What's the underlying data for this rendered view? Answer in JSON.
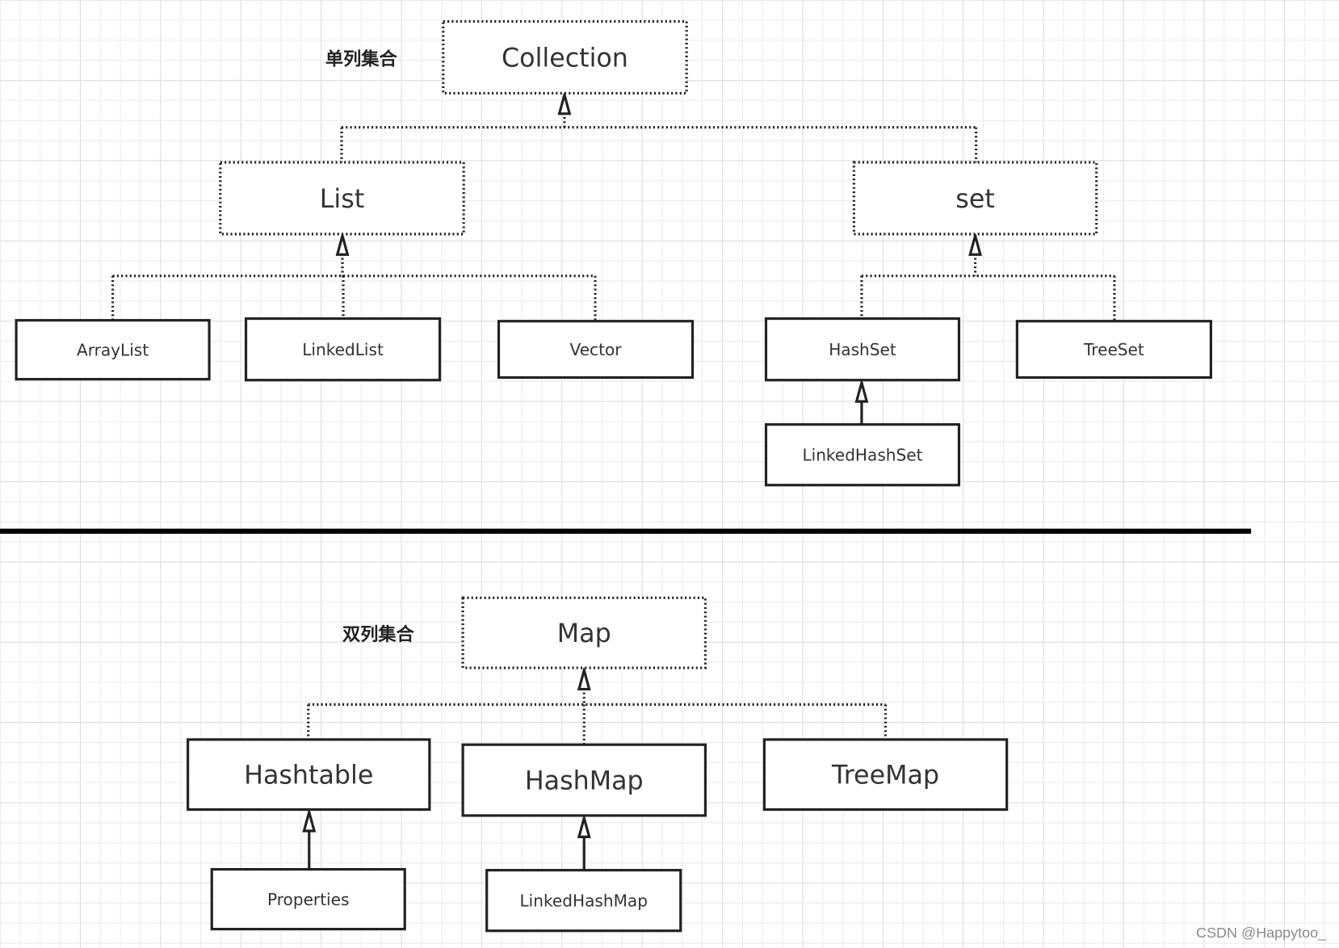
{
  "labels": {
    "single_column": "单列集合",
    "double_column": "双列集合",
    "watermark": "CSDN @Happytoo_"
  },
  "colors": {
    "line": "#222222",
    "grid_minor": "#ececec",
    "grid_major": "#dcdcdc",
    "separator": "#000000"
  },
  "nodes": [
    {
      "id": "collection",
      "label": "Collection",
      "kind": "interface"
    },
    {
      "id": "list",
      "label": "List",
      "kind": "interface"
    },
    {
      "id": "set",
      "label": "set",
      "kind": "interface"
    },
    {
      "id": "arraylist",
      "label": "ArrayList",
      "kind": "class"
    },
    {
      "id": "linkedlist",
      "label": "LinkedList",
      "kind": "class"
    },
    {
      "id": "vector",
      "label": "Vector",
      "kind": "class"
    },
    {
      "id": "hashset",
      "label": "HashSet",
      "kind": "class"
    },
    {
      "id": "treeset",
      "label": "TreeSet",
      "kind": "class"
    },
    {
      "id": "linkedhashset",
      "label": "LinkedHashSet",
      "kind": "class"
    },
    {
      "id": "map",
      "label": "Map",
      "kind": "interface"
    },
    {
      "id": "hashtable",
      "label": "Hashtable",
      "kind": "class"
    },
    {
      "id": "hashmap",
      "label": "HashMap",
      "kind": "class"
    },
    {
      "id": "treemap",
      "label": "TreeMap",
      "kind": "class"
    },
    {
      "id": "properties",
      "label": "Properties",
      "kind": "class"
    },
    {
      "id": "linkedhashmap",
      "label": "LinkedHashMap",
      "kind": "class"
    }
  ],
  "edges": [
    {
      "from": "list",
      "to": "collection",
      "style": "realization"
    },
    {
      "from": "set",
      "to": "collection",
      "style": "realization"
    },
    {
      "from": "arraylist",
      "to": "list",
      "style": "realization"
    },
    {
      "from": "linkedlist",
      "to": "list",
      "style": "realization"
    },
    {
      "from": "vector",
      "to": "list",
      "style": "realization"
    },
    {
      "from": "hashset",
      "to": "set",
      "style": "realization"
    },
    {
      "from": "treeset",
      "to": "set",
      "style": "realization"
    },
    {
      "from": "linkedhashset",
      "to": "hashset",
      "style": "inheritance"
    },
    {
      "from": "hashtable",
      "to": "map",
      "style": "realization"
    },
    {
      "from": "hashmap",
      "to": "map",
      "style": "realization"
    },
    {
      "from": "treemap",
      "to": "map",
      "style": "realization"
    },
    {
      "from": "properties",
      "to": "hashtable",
      "style": "inheritance"
    },
    {
      "from": "linkedhashmap",
      "to": "hashmap",
      "style": "inheritance"
    }
  ]
}
